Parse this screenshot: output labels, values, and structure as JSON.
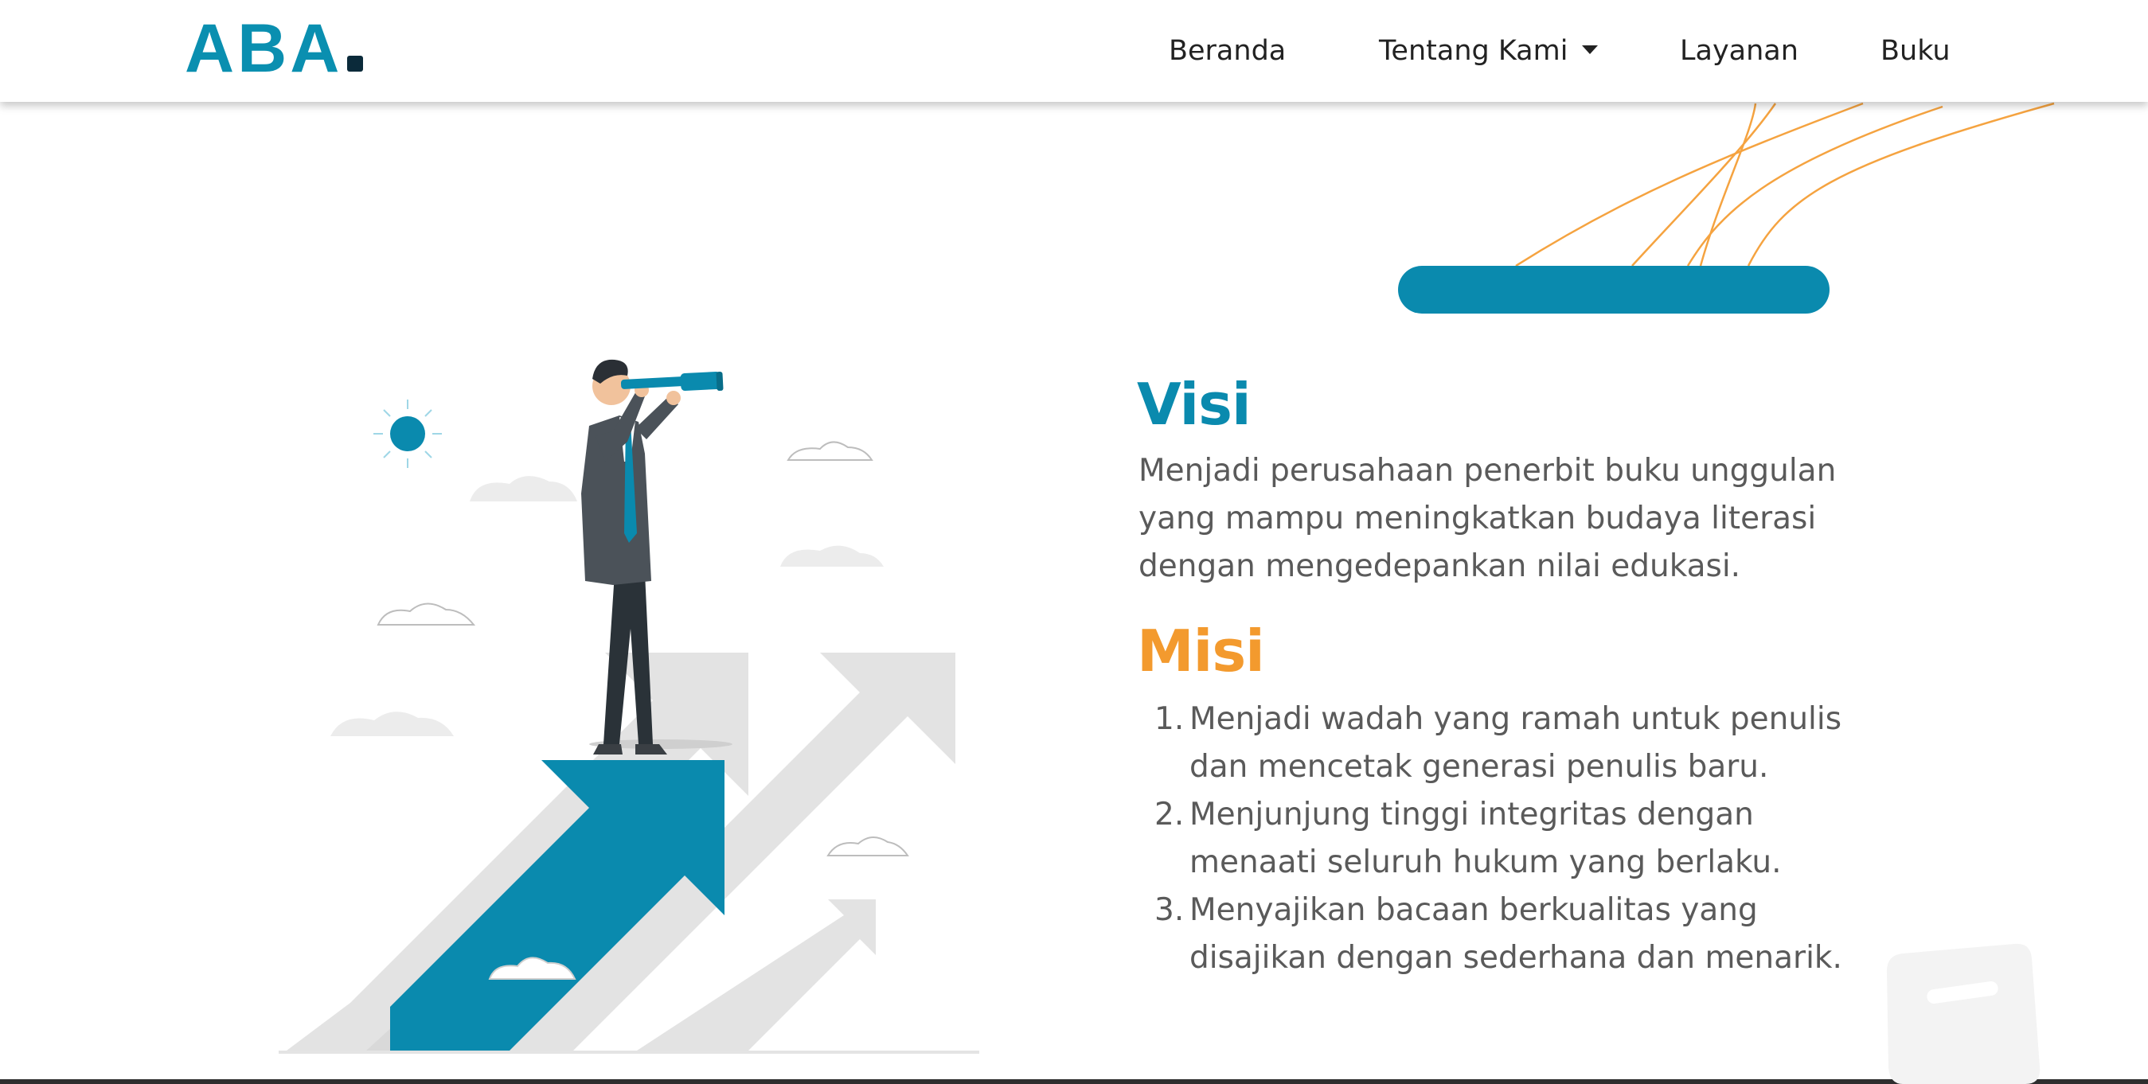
{
  "brand": {
    "logo_text": "ABA"
  },
  "nav": {
    "items": [
      {
        "label": "Beranda"
      },
      {
        "label": "Tentang Kami",
        "has_dropdown": true
      },
      {
        "label": "Layanan"
      },
      {
        "label": "Buku"
      }
    ]
  },
  "visi": {
    "title": "Visi",
    "lines": [
      "Menjadi perusahaan penerbit buku unggulan",
      "yang mampu meningkatkan budaya literasi",
      "dengan mengedepankan nilai edukasi."
    ]
  },
  "misi": {
    "title": "Misi",
    "items": [
      {
        "number": "1.",
        "lines": [
          "Menjadi wadah yang ramah untuk penulis",
          "dan mencetak generasi penulis baru."
        ]
      },
      {
        "number": "2.",
        "lines": [
          "Menjunjung tinggi integritas dengan",
          "menaati seluruh hukum yang berlaku."
        ]
      },
      {
        "number": "3.",
        "lines": [
          "Menyajikan bacaan berkualitas yang",
          "disajikan dengan sederhana dan menarik."
        ]
      }
    ]
  },
  "colors": {
    "brand_teal": "#0a8aae",
    "accent_orange": "#f39a2e",
    "body_text": "#5a5a5a",
    "nav_text": "#222222"
  },
  "icons": {
    "nav_dropdown": "caret-down-icon",
    "illustration": "businessman-telescope-illustration"
  }
}
